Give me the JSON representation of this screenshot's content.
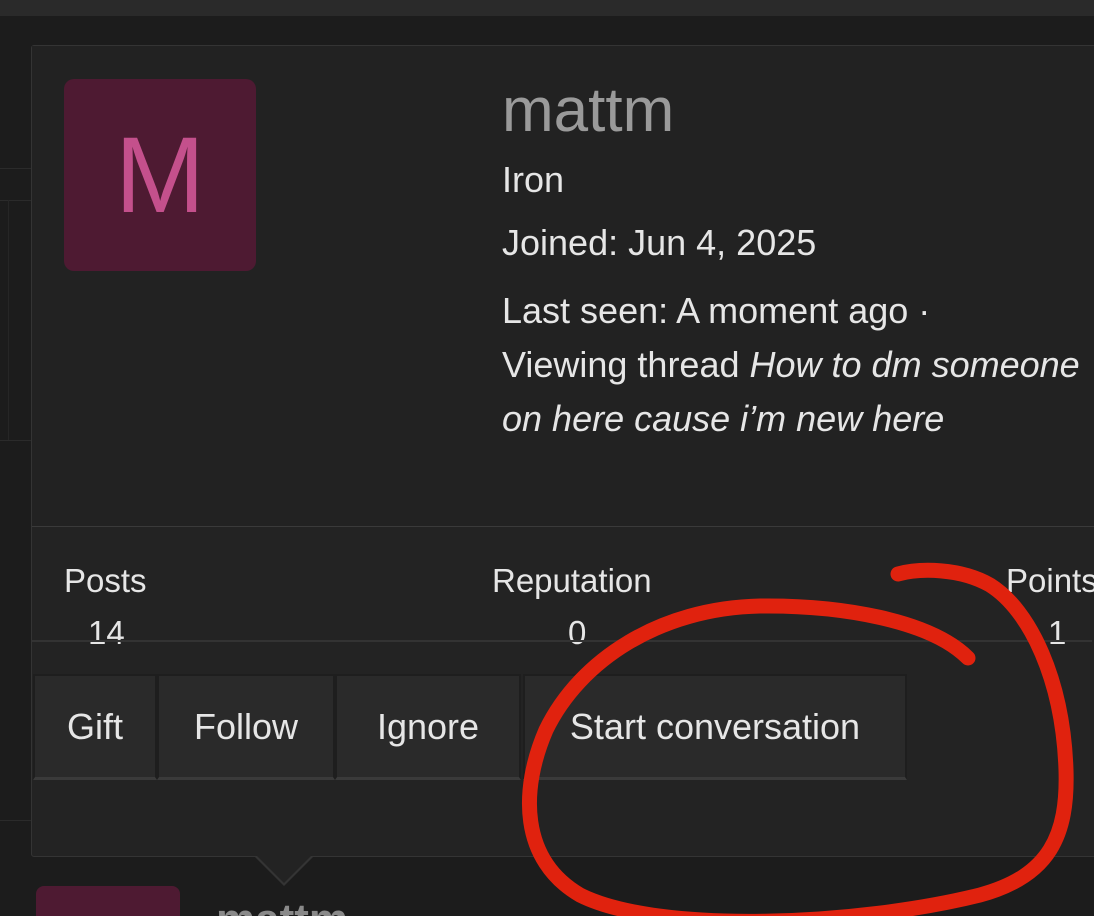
{
  "profile": {
    "avatar_letter": "M",
    "username": "mattm",
    "rank": "Iron",
    "joined_label": "Joined:",
    "joined_value": "Jun 4, 2025",
    "last_seen_label": "Last seen:",
    "last_seen_value": "A moment ago ·",
    "activity_prefix": "Viewing thread",
    "activity_thread": "How to dm someone on here cause i’m new here"
  },
  "stats": {
    "posts_label": "Posts",
    "posts_value": "14",
    "reputation_label": "Reputation",
    "reputation_value": "0",
    "points_label": "Points",
    "points_value": "1"
  },
  "actions": {
    "gift": "Gift",
    "follow": "Follow",
    "ignore": "Ignore",
    "start_conversation": "Start conversation"
  },
  "below": {
    "username": "mattm"
  },
  "colors": {
    "avatar_bg": "#4e1a32",
    "avatar_letter": "#c4508c",
    "annotation": "#e0220e"
  }
}
